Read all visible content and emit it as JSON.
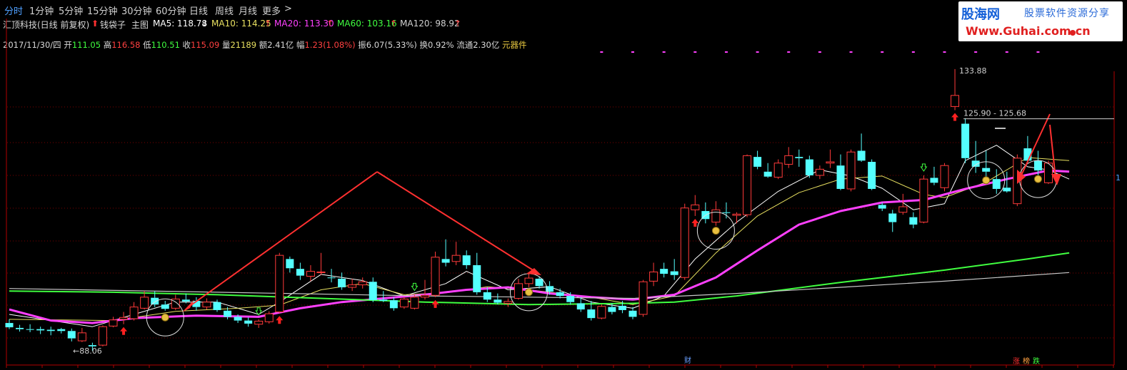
{
  "toolbar": {
    "tabs": [
      "分时",
      "1分钟",
      "5分钟",
      "15分钟",
      "30分钟",
      "60分钟",
      "日线",
      "周线",
      "月线",
      "更多"
    ],
    "more_arrow": ">"
  },
  "logo": {
    "brand": "股海网",
    "slogan": "股票软件资源分享",
    "url": "Www.Guhai.com.cn"
  },
  "header": {
    "stock_title": "汇顶科技(日线 前复权)",
    "indicator_name": "钱袋子",
    "main_label": "主图",
    "ma": [
      {
        "label": "MA5: 118.78",
        "arrow": "↓",
        "color": "#ffffff",
        "arrow_color": "#ffffff"
      },
      {
        "label": "MA10: 114.25",
        "arrow": "↑",
        "color": "#e8e060",
        "arrow_color": "#ff4040"
      },
      {
        "label": "MA20: 113.30",
        "arrow": "↑",
        "color": "#ff40ff",
        "arrow_color": "#ff4040"
      },
      {
        "label": "MA60: 103.16",
        "arrow": "↑",
        "color": "#40ff40",
        "arrow_color": "#ff4040"
      },
      {
        "label": "MA120: 98.92",
        "arrow": "↑",
        "color": "#d0d0d0",
        "arrow_color": "#ff4040"
      }
    ]
  },
  "info": {
    "date": "2017/11/30/四",
    "open_label": "开",
    "open": "111.05",
    "high_label": "高",
    "high": "116.58",
    "low_label": "低",
    "low": "110.51",
    "close_label": "收",
    "close": "115.09",
    "vol_label": "量",
    "vol": "21189",
    "amt_label": "额",
    "amt": "2.41亿",
    "chg_label": "幅",
    "chg": "1.23(1.08%)",
    "amp_label": "振",
    "amp": "6.07(5.33%)",
    "turn_label": "换",
    "turn": "0.92%",
    "float_label": "流通",
    "float": "2.30亿",
    "sector": "元器件"
  },
  "annotations": {
    "high_price": "133.88",
    "range_label": "125.90 - 125.68",
    "low_price": "88.06",
    "low_arrow": "←",
    "right_edge_mark": "1",
    "cai": "财",
    "zhang": "涨",
    "bang": "榜",
    "die": "跌"
  },
  "colors": {
    "up": "#ff3a3a",
    "down": "#54ffff",
    "ma5": "#ffffff",
    "ma10": "#e8e060",
    "ma20": "#ff40ff",
    "ma60": "#40ff40",
    "ma120": "#c8c8c8",
    "grid": "#7a0000",
    "active_tab": "#4fa0ff"
  },
  "chart_data": {
    "type": "candlestick",
    "ylim": [
      86,
      137
    ],
    "candles": [
      {
        "o": 92.6,
        "h": 93.2,
        "l": 91.6,
        "c": 91.9
      },
      {
        "o": 91.8,
        "h": 92.3,
        "l": 91.2,
        "c": 91.6
      },
      {
        "o": 91.6,
        "h": 92.4,
        "l": 91.1,
        "c": 91.5
      },
      {
        "o": 91.6,
        "h": 92.0,
        "l": 90.8,
        "c": 91.4
      },
      {
        "o": 91.5,
        "h": 92.0,
        "l": 90.6,
        "c": 91.3
      },
      {
        "o": 91.6,
        "h": 91.8,
        "l": 90.9,
        "c": 91.3
      },
      {
        "o": 91.3,
        "h": 91.7,
        "l": 89.6,
        "c": 90.1
      },
      {
        "o": 89.7,
        "h": 91.8,
        "l": 89.5,
        "c": 91.0
      },
      {
        "o": 89.0,
        "h": 89.4,
        "l": 88.06,
        "c": 88.8
      },
      {
        "o": 89.0,
        "h": 92.2,
        "l": 88.8,
        "c": 92.0
      },
      {
        "o": 92.1,
        "h": 93.6,
        "l": 91.9,
        "c": 93.1
      },
      {
        "o": 93.2,
        "h": 94.4,
        "l": 92.4,
        "c": 93.5
      },
      {
        "o": 93.3,
        "h": 96.0,
        "l": 93.0,
        "c": 95.2
      },
      {
        "o": 95.0,
        "h": 97.8,
        "l": 94.8,
        "c": 96.8
      },
      {
        "o": 96.7,
        "h": 97.8,
        "l": 95.2,
        "c": 95.6
      },
      {
        "o": 95.6,
        "h": 96.2,
        "l": 94.6,
        "c": 94.9
      },
      {
        "o": 95.0,
        "h": 97.2,
        "l": 94.7,
        "c": 96.5
      },
      {
        "o": 96.4,
        "h": 97.4,
        "l": 95.8,
        "c": 96.1
      },
      {
        "o": 96.2,
        "h": 96.8,
        "l": 94.6,
        "c": 95.2
      },
      {
        "o": 95.2,
        "h": 96.6,
        "l": 94.8,
        "c": 96.0
      },
      {
        "o": 96.0,
        "h": 96.4,
        "l": 94.4,
        "c": 94.7
      },
      {
        "o": 94.6,
        "h": 95.2,
        "l": 93.2,
        "c": 93.6
      },
      {
        "o": 93.6,
        "h": 94.0,
        "l": 92.6,
        "c": 93.0
      },
      {
        "o": 93.0,
        "h": 93.5,
        "l": 92.0,
        "c": 92.5
      },
      {
        "o": 92.4,
        "h": 93.2,
        "l": 91.8,
        "c": 92.9
      },
      {
        "o": 92.8,
        "h": 94.5,
        "l": 92.5,
        "c": 94.1
      },
      {
        "o": 94.4,
        "h": 104.0,
        "l": 94.2,
        "c": 103.6
      },
      {
        "o": 103.0,
        "h": 103.4,
        "l": 100.8,
        "c": 101.5
      },
      {
        "o": 101.4,
        "h": 102.4,
        "l": 99.6,
        "c": 100.3
      },
      {
        "o": 100.2,
        "h": 102.0,
        "l": 99.4,
        "c": 101.0
      },
      {
        "o": 100.8,
        "h": 104.0,
        "l": 100.4,
        "c": 100.9
      },
      {
        "o": 100.0,
        "h": 101.4,
        "l": 99.2,
        "c": 99.9
      },
      {
        "o": 99.8,
        "h": 100.8,
        "l": 98.0,
        "c": 98.4
      },
      {
        "o": 98.4,
        "h": 99.8,
        "l": 97.8,
        "c": 98.8
      },
      {
        "o": 98.8,
        "h": 100.0,
        "l": 98.2,
        "c": 99.3
      },
      {
        "o": 99.3,
        "h": 100.0,
        "l": 96.0,
        "c": 96.3
      },
      {
        "o": 96.4,
        "h": 97.8,
        "l": 96.0,
        "c": 96.2
      },
      {
        "o": 96.3,
        "h": 96.8,
        "l": 94.6,
        "c": 95.0
      },
      {
        "o": 95.2,
        "h": 96.8,
        "l": 94.9,
        "c": 96.5
      },
      {
        "o": 95.0,
        "h": 97.2,
        "l": 94.8,
        "c": 96.8
      },
      {
        "o": 96.8,
        "h": 99.6,
        "l": 96.4,
        "c": 97.1
      },
      {
        "o": 97.1,
        "h": 104.2,
        "l": 96.8,
        "c": 103.3
      },
      {
        "o": 103.0,
        "h": 106.2,
        "l": 101.8,
        "c": 102.4
      },
      {
        "o": 102.6,
        "h": 105.8,
        "l": 102.0,
        "c": 103.6
      },
      {
        "o": 103.6,
        "h": 104.4,
        "l": 101.4,
        "c": 102.0
      },
      {
        "o": 102.0,
        "h": 104.0,
        "l": 97.2,
        "c": 97.6
      },
      {
        "o": 97.6,
        "h": 98.4,
        "l": 96.0,
        "c": 96.4
      },
      {
        "o": 96.4,
        "h": 97.4,
        "l": 95.6,
        "c": 95.9
      },
      {
        "o": 95.8,
        "h": 96.6,
        "l": 95.2,
        "c": 96.1
      },
      {
        "o": 96.6,
        "h": 99.8,
        "l": 96.4,
        "c": 99.0
      },
      {
        "o": 99.0,
        "h": 100.6,
        "l": 98.4,
        "c": 99.9
      },
      {
        "o": 99.8,
        "h": 100.2,
        "l": 98.2,
        "c": 98.6
      },
      {
        "o": 98.6,
        "h": 99.4,
        "l": 97.2,
        "c": 97.7
      },
      {
        "o": 97.6,
        "h": 98.2,
        "l": 96.6,
        "c": 97.0
      },
      {
        "o": 97.0,
        "h": 97.6,
        "l": 95.6,
        "c": 96.0
      },
      {
        "o": 95.8,
        "h": 96.8,
        "l": 94.4,
        "c": 94.8
      },
      {
        "o": 94.8,
        "h": 96.2,
        "l": 93.0,
        "c": 93.4
      },
      {
        "o": 93.4,
        "h": 95.6,
        "l": 93.2,
        "c": 95.3
      },
      {
        "o": 95.2,
        "h": 95.8,
        "l": 94.0,
        "c": 94.4
      },
      {
        "o": 95.4,
        "h": 96.2,
        "l": 94.2,
        "c": 94.7
      },
      {
        "o": 94.6,
        "h": 95.2,
        "l": 93.2,
        "c": 93.6
      },
      {
        "o": 94.0,
        "h": 99.6,
        "l": 93.6,
        "c": 99.3
      },
      {
        "o": 99.4,
        "h": 102.4,
        "l": 98.6,
        "c": 100.9
      },
      {
        "o": 101.4,
        "h": 102.4,
        "l": 100.0,
        "c": 100.6
      },
      {
        "o": 101.0,
        "h": 103.0,
        "l": 99.6,
        "c": 100.4
      },
      {
        "o": 100.0,
        "h": 112.0,
        "l": 99.6,
        "c": 111.3
      },
      {
        "o": 111.0,
        "h": 113.4,
        "l": 110.0,
        "c": 111.8
      },
      {
        "o": 110.8,
        "h": 112.2,
        "l": 108.8,
        "c": 109.5
      },
      {
        "o": 109.0,
        "h": 112.4,
        "l": 108.4,
        "c": 111.0
      },
      {
        "o": 110.6,
        "h": 112.2,
        "l": 109.6,
        "c": 110.5
      },
      {
        "o": 110.1,
        "h": 110.6,
        "l": 108.8,
        "c": 110.3
      },
      {
        "o": 110.2,
        "h": 120.0,
        "l": 109.8,
        "c": 119.8
      },
      {
        "o": 119.6,
        "h": 120.6,
        "l": 117.6,
        "c": 118.0
      },
      {
        "o": 117.2,
        "h": 118.6,
        "l": 116.2,
        "c": 116.4
      },
      {
        "o": 116.3,
        "h": 119.2,
        "l": 116.0,
        "c": 118.6
      },
      {
        "o": 118.4,
        "h": 121.2,
        "l": 117.8,
        "c": 119.8
      },
      {
        "o": 119.6,
        "h": 120.8,
        "l": 118.0,
        "c": 119.4
      },
      {
        "o": 119.2,
        "h": 119.8,
        "l": 116.2,
        "c": 116.6
      },
      {
        "o": 116.6,
        "h": 118.2,
        "l": 116.0,
        "c": 117.6
      },
      {
        "o": 118.6,
        "h": 120.8,
        "l": 117.8,
        "c": 118.8
      },
      {
        "o": 118.2,
        "h": 120.0,
        "l": 114.2,
        "c": 114.4
      },
      {
        "o": 114.4,
        "h": 120.8,
        "l": 114.0,
        "c": 120.4
      },
      {
        "o": 120.6,
        "h": 123.4,
        "l": 118.8,
        "c": 119.0
      },
      {
        "o": 118.8,
        "h": 119.2,
        "l": 114.2,
        "c": 114.4
      },
      {
        "o": 111.8,
        "h": 112.2,
        "l": 110.8,
        "c": 111.2
      },
      {
        "o": 110.4,
        "h": 111.0,
        "l": 107.4,
        "c": 109.0
      },
      {
        "o": 110.6,
        "h": 113.6,
        "l": 110.2,
        "c": 111.5
      },
      {
        "o": 109.8,
        "h": 110.6,
        "l": 108.0,
        "c": 108.6
      },
      {
        "o": 109.0,
        "h": 116.6,
        "l": 108.8,
        "c": 116.0
      },
      {
        "o": 116.2,
        "h": 118.0,
        "l": 115.0,
        "c": 115.4
      },
      {
        "o": 114.6,
        "h": 118.6,
        "l": 114.0,
        "c": 118.2
      },
      {
        "o": 127.8,
        "h": 133.88,
        "l": 127.2,
        "c": 129.6
      },
      {
        "o": 125.0,
        "h": 125.9,
        "l": 118.6,
        "c": 119.4
      },
      {
        "o": 119.0,
        "h": 122.2,
        "l": 117.0,
        "c": 118.0
      },
      {
        "o": 117.8,
        "h": 120.6,
        "l": 115.6,
        "c": 117.2
      },
      {
        "o": 116.0,
        "h": 117.6,
        "l": 113.6,
        "c": 114.4
      },
      {
        "o": 114.6,
        "h": 117.2,
        "l": 113.8,
        "c": 114.0
      },
      {
        "o": 112.0,
        "h": 120.0,
        "l": 111.6,
        "c": 119.4
      },
      {
        "o": 121.0,
        "h": 123.0,
        "l": 118.6,
        "c": 119.0
      },
      {
        "o": 119.0,
        "h": 120.6,
        "l": 116.2,
        "c": 117.4
      },
      {
        "o": 115.4,
        "h": 119.0,
        "l": 115.2,
        "c": 118.6
      }
    ],
    "ma": {
      "MA5": [
        [
          0,
          94.0
        ],
        [
          8,
          92.0
        ],
        [
          12,
          94.0
        ],
        [
          16,
          96.0
        ],
        [
          20,
          96.0
        ],
        [
          24,
          94.0
        ],
        [
          26,
          96.0
        ],
        [
          30,
          100.5
        ],
        [
          34,
          99.5
        ],
        [
          38,
          97.0
        ],
        [
          42,
          99.0
        ],
        [
          44,
          101.0
        ],
        [
          48,
          98.0
        ],
        [
          52,
          98.5
        ],
        [
          56,
          96.0
        ],
        [
          60,
          95.0
        ],
        [
          63,
          97.0
        ],
        [
          66,
          103.0
        ],
        [
          70,
          109.0
        ],
        [
          74,
          114.0
        ],
        [
          78,
          117.5
        ],
        [
          81,
          116.5
        ],
        [
          84,
          114.5
        ],
        [
          87,
          111.0
        ],
        [
          90,
          112.0
        ],
        [
          92,
          119.0
        ],
        [
          95,
          121.5
        ],
        [
          98,
          118.0
        ],
        [
          100,
          117.5
        ],
        [
          102,
          116.0
        ]
      ],
      "MA10": [
        [
          0,
          93.2
        ],
        [
          10,
          93.0
        ],
        [
          16,
          94.5
        ],
        [
          22,
          95.0
        ],
        [
          26,
          95.5
        ],
        [
          30,
          98.0
        ],
        [
          34,
          99.0
        ],
        [
          38,
          97.2
        ],
        [
          42,
          97.5
        ],
        [
          46,
          98.5
        ],
        [
          50,
          98.0
        ],
        [
          56,
          96.8
        ],
        [
          60,
          95.6
        ],
        [
          64,
          97.0
        ],
        [
          68,
          104.0
        ],
        [
          72,
          110.0
        ],
        [
          76,
          113.8
        ],
        [
          80,
          116.0
        ],
        [
          84,
          116.5
        ],
        [
          88,
          113.5
        ],
        [
          90,
          113.0
        ],
        [
          94,
          115.5
        ],
        [
          98,
          119.5
        ],
        [
          102,
          119.0
        ]
      ],
      "MA20": [
        [
          0,
          94.8
        ],
        [
          4,
          93.0
        ],
        [
          8,
          92.6
        ],
        [
          12,
          93.4
        ],
        [
          18,
          93.8
        ],
        [
          24,
          93.6
        ],
        [
          28,
          95.0
        ],
        [
          32,
          96.0
        ],
        [
          36,
          96.6
        ],
        [
          40,
          97.2
        ],
        [
          44,
          98.0
        ],
        [
          48,
          98.4
        ],
        [
          52,
          97.4
        ],
        [
          56,
          96.8
        ],
        [
          60,
          96.4
        ],
        [
          64,
          97.2
        ],
        [
          68,
          100.0
        ],
        [
          72,
          104.4
        ],
        [
          76,
          108.6
        ],
        [
          80,
          110.8
        ],
        [
          84,
          112.2
        ],
        [
          88,
          112.6
        ],
        [
          92,
          114.4
        ],
        [
          96,
          116.0
        ],
        [
          100,
          117.4
        ],
        [
          102,
          117.2
        ]
      ],
      "MA60": [
        [
          0,
          97.8
        ],
        [
          10,
          97.6
        ],
        [
          20,
          97.2
        ],
        [
          30,
          96.6
        ],
        [
          40,
          96.0
        ],
        [
          50,
          95.6
        ],
        [
          60,
          95.8
        ],
        [
          64,
          96.0
        ],
        [
          70,
          97.0
        ],
        [
          80,
          99.2
        ],
        [
          90,
          101.2
        ],
        [
          98,
          103.0
        ],
        [
          102,
          104.0
        ]
      ],
      "MA120": [
        [
          0,
          98.2
        ],
        [
          20,
          97.6
        ],
        [
          40,
          97.0
        ],
        [
          60,
          96.6
        ],
        [
          70,
          97.4
        ],
        [
          80,
          98.4
        ],
        [
          90,
          99.4
        ],
        [
          102,
          100.8
        ]
      ]
    },
    "signals": [
      {
        "type": "coin",
        "i": 15
      },
      {
        "type": "coin",
        "i": 50
      },
      {
        "type": "coin",
        "i": 68
      },
      {
        "type": "coin",
        "i": 94
      },
      {
        "type": "coin",
        "i": 99
      },
      {
        "type": "up-arrow",
        "i": 11
      },
      {
        "type": "up-arrow",
        "i": 26
      },
      {
        "type": "up-arrow",
        "i": 41
      },
      {
        "type": "up-arrow",
        "i": 66
      },
      {
        "type": "up-arrow",
        "i": 91
      },
      {
        "type": "hollow-arrow",
        "i": 24
      },
      {
        "type": "hollow-arrow",
        "i": 39
      },
      {
        "type": "hollow-arrow",
        "i": 88
      }
    ]
  }
}
